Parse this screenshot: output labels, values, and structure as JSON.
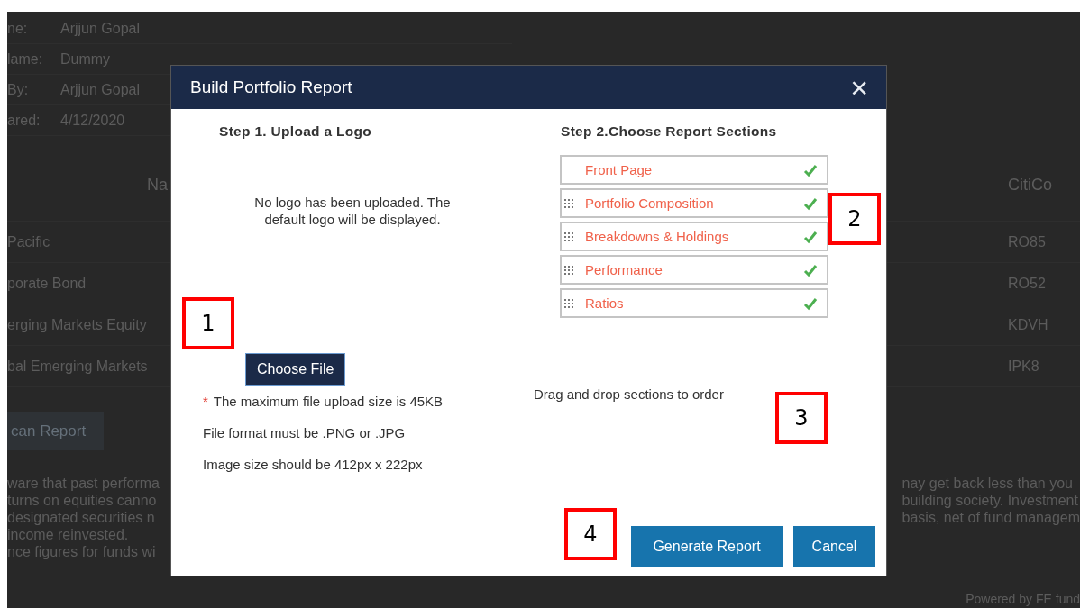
{
  "background_page": {
    "details": [
      {
        "label": "ne:",
        "value": "Arjjun Gopal"
      },
      {
        "label": "lame:",
        "value": "Dummy"
      },
      {
        "label": "By:",
        "value": "Arjjun Gopal"
      },
      {
        "label": "ared:",
        "value": "4/12/2020"
      }
    ],
    "table": {
      "columns": [
        "Na",
        "CitiCo"
      ],
      "rows": [
        [
          "Pacific",
          "RO85"
        ],
        [
          "porate Bond",
          "RO52"
        ],
        [
          "erging Markets Equity",
          "KDVH"
        ],
        [
          "bal Emerging Markets",
          "IPK8"
        ]
      ]
    },
    "button": "can Report",
    "disclaimer_left": [
      "ware that past performa",
      "turns on equities canno",
      "designated securities n",
      "income reinvested.",
      "nce figures for funds wi"
    ],
    "disclaimer_right": [
      "nay get back less than you",
      "building society. Investment",
      "basis, net of fund managem"
    ],
    "footer": "Powered by FE fund"
  },
  "dialog": {
    "title": "Build Portfolio Report",
    "close": "×",
    "step1": {
      "heading": "Step 1. Upload a Logo",
      "message": "No logo has been uploaded. The default logo will be displayed.",
      "button": "Choose File",
      "required_mark": "*",
      "notes": [
        "The maximum file upload size is 45KB",
        "File format must be .PNG or .JPG",
        "Image size should be 412px x 222px"
      ]
    },
    "step2": {
      "heading": "Step 2.Choose Report Sections",
      "sections": [
        {
          "label": "Front Page",
          "checked": true,
          "draggable": false
        },
        {
          "label": "Portfolio Composition",
          "checked": true,
          "draggable": true
        },
        {
          "label": "Breakdowns & Holdings",
          "checked": true,
          "draggable": true
        },
        {
          "label": "Performance",
          "checked": true,
          "draggable": true
        },
        {
          "label": "Ratios",
          "checked": true,
          "draggable": true
        }
      ],
      "hint": "Drag and drop sections to order"
    },
    "buttons": [
      "Generate Report",
      "Cancel"
    ]
  },
  "callouts": [
    "1",
    "2",
    "3",
    "4"
  ]
}
